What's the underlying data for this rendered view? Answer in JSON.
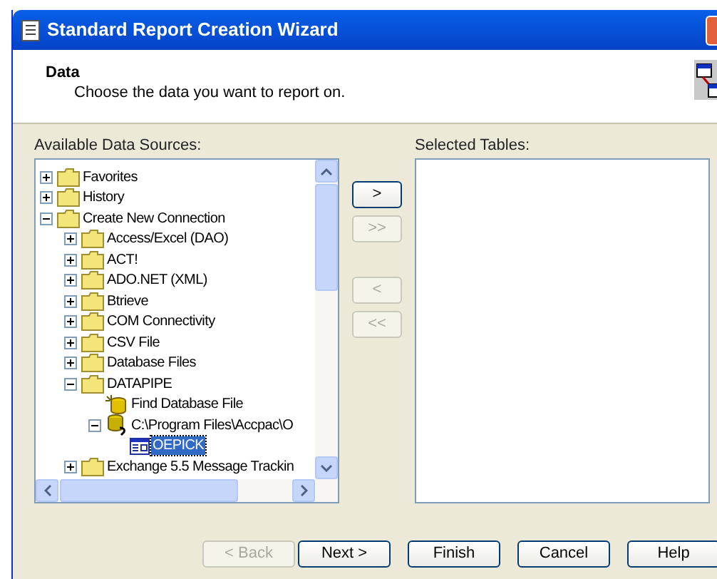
{
  "window": {
    "title": "Standard Report Creation Wizard"
  },
  "header": {
    "title": "Data",
    "subtitle": "Choose the data you want to report on."
  },
  "available": {
    "label": "Available Data Sources:",
    "tree": [
      {
        "label": "Favorites",
        "kind": "folder",
        "expanded": false
      },
      {
        "label": "History",
        "kind": "folder",
        "expanded": false
      },
      {
        "label": "Create New Connection",
        "kind": "folder",
        "expanded": true,
        "children": [
          {
            "label": "Access/Excel (DAO)",
            "kind": "folder",
            "expanded": false
          },
          {
            "label": "ACT!",
            "kind": "folder",
            "expanded": false
          },
          {
            "label": "ADO.NET (XML)",
            "kind": "folder",
            "expanded": false
          },
          {
            "label": "Btrieve",
            "kind": "folder",
            "expanded": false
          },
          {
            "label": "COM Connectivity",
            "kind": "folder",
            "expanded": false
          },
          {
            "label": "CSV File",
            "kind": "folder",
            "expanded": false
          },
          {
            "label": "Database Files",
            "kind": "folder",
            "expanded": false
          },
          {
            "label": "DATAPIPE",
            "kind": "folder",
            "expanded": true,
            "children": [
              {
                "label": "Find Database File",
                "kind": "find"
              },
              {
                "label": "C:\\Program Files\\Accpac\\O",
                "kind": "connection",
                "expanded": true,
                "children": [
                  {
                    "label": "OEPICK",
                    "kind": "table",
                    "selected": true
                  }
                ]
              }
            ]
          },
          {
            "label": "Exchange 5.5 Message Trackin",
            "kind": "folder",
            "expanded": false
          }
        ]
      }
    ]
  },
  "transfer_buttons": [
    {
      "label": ">",
      "disabled": false
    },
    {
      "label": ">>",
      "disabled": true
    },
    {
      "label": "<",
      "disabled": true
    },
    {
      "label": "<<",
      "disabled": true
    }
  ],
  "selected": {
    "label": "Selected Tables:"
  },
  "buttons": [
    {
      "label": "< Back",
      "disabled": true
    },
    {
      "label": "Next >",
      "disabled": false
    },
    {
      "label": "Finish",
      "disabled": false
    },
    {
      "label": "Cancel",
      "disabled": false
    },
    {
      "label": "Help",
      "disabled": false
    }
  ]
}
